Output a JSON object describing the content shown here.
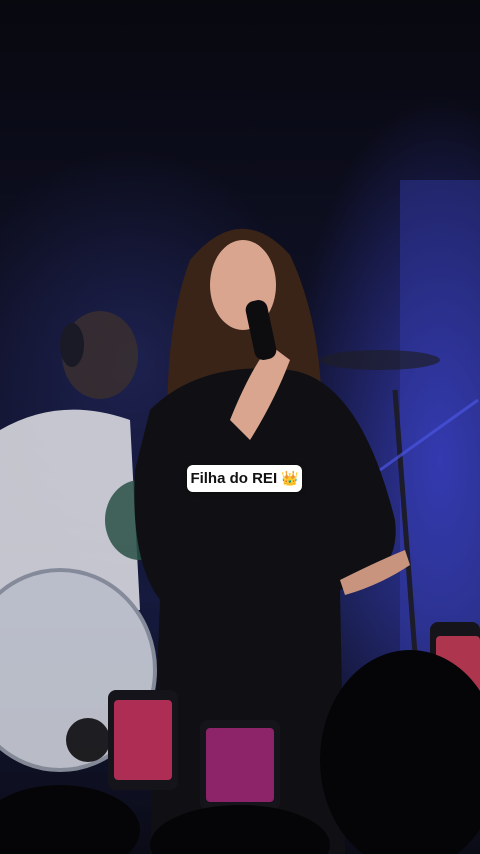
{
  "caption": {
    "text": "Filha do REI",
    "emoji": "👑"
  },
  "scene": {
    "colors": {
      "stage_blue": "#3a40c8",
      "dark": "#0a0a14",
      "drum_head": "#d8dce4",
      "shirt": "#e6e6ea",
      "phone_screen": "#e0356a"
    }
  }
}
